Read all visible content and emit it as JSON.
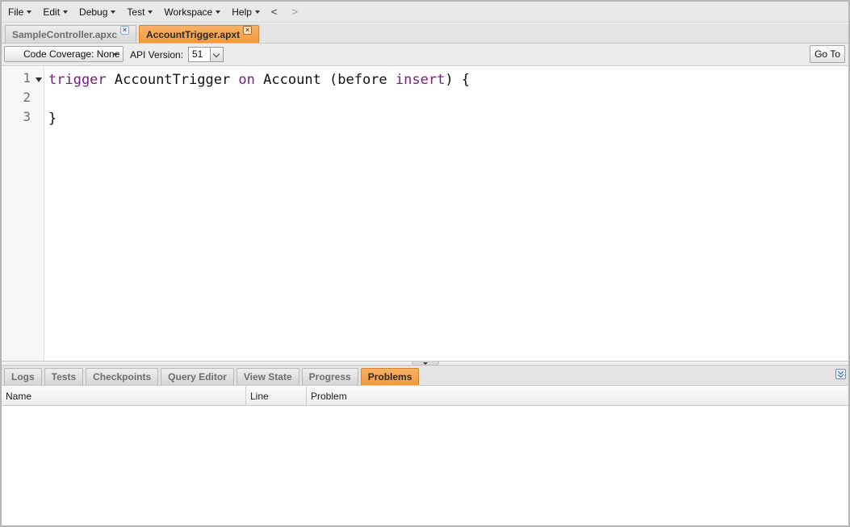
{
  "menu": {
    "items": [
      {
        "label": "File"
      },
      {
        "label": "Edit"
      },
      {
        "label": "Debug"
      },
      {
        "label": "Test"
      },
      {
        "label": "Workspace"
      },
      {
        "label": "Help"
      }
    ],
    "back": "<",
    "forward": ">"
  },
  "file_tabs": [
    {
      "label": "SampleController.apxc",
      "active": false
    },
    {
      "label": "AccountTrigger.apxt",
      "active": true
    }
  ],
  "toolbar": {
    "coverage_label": "Code Coverage: None",
    "api_label": "API Version:",
    "api_value": "51",
    "goto_label": "Go To"
  },
  "editor": {
    "line_numbers": [
      "1",
      "2",
      "3"
    ],
    "lines": [
      [
        {
          "text": "trigger",
          "kind": "kw"
        },
        {
          "text": " AccountTrigger ",
          "kind": "plain"
        },
        {
          "text": "on",
          "kind": "kw"
        },
        {
          "text": " Account (before ",
          "kind": "plain"
        },
        {
          "text": "insert",
          "kind": "kw"
        },
        {
          "text": ") {",
          "kind": "plain"
        }
      ],
      [],
      [
        {
          "text": "}",
          "kind": "plain"
        }
      ]
    ]
  },
  "bottom_tabs": [
    {
      "label": "Logs",
      "active": false
    },
    {
      "label": "Tests",
      "active": false
    },
    {
      "label": "Checkpoints",
      "active": false
    },
    {
      "label": "Query Editor",
      "active": false
    },
    {
      "label": "View State",
      "active": false
    },
    {
      "label": "Progress",
      "active": false
    },
    {
      "label": "Problems",
      "active": true
    }
  ],
  "problems": {
    "columns": [
      "Name",
      "Line",
      "Problem"
    ],
    "rows": []
  }
}
